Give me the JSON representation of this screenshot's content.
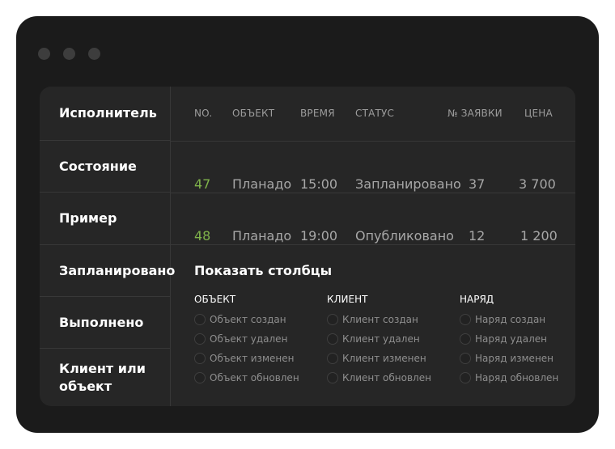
{
  "window": {
    "controls": [
      "window-dot-1",
      "window-dot-2",
      "window-dot-3"
    ]
  },
  "sidebar": {
    "items": [
      {
        "label": "Исполнитель"
      },
      {
        "label": "Состояние"
      },
      {
        "label": "Пример"
      },
      {
        "label": "Запланировано"
      },
      {
        "label": "Выполнено"
      },
      {
        "label": "Клиент или объект"
      }
    ]
  },
  "table": {
    "headers": [
      "NO.",
      "ОБЪЕКТ",
      "ВРЕМЯ",
      "СТАТУС",
      "№ ЗАЯВКИ",
      "ЦЕНА"
    ],
    "rows": [
      {
        "no": "47",
        "object": "Планадо",
        "time": "15:00",
        "status": "Запланировано",
        "request": "37",
        "price": "3 700"
      },
      {
        "no": "48",
        "object": "Планадо",
        "time": "19:00",
        "status": "Опубликовано",
        "request": "12",
        "price": "1 200"
      }
    ],
    "accent_color": "#7fb24a"
  },
  "columns_panel": {
    "title": "Показать столбцы",
    "groups": [
      {
        "title": "ОБЪЕКТ",
        "options": [
          "Объект создан",
          "Объект удален",
          "Объект изменен",
          "Объект обновлен"
        ]
      },
      {
        "title": "КЛИЕНТ",
        "options": [
          "Клиент создан",
          "Клиент удален",
          "Клиент изменен",
          "Клиент обновлен"
        ]
      },
      {
        "title": "НАРЯД",
        "options": [
          "Наряд создан",
          "Наряд удален",
          "Наряд изменен",
          "Наряд обновлен"
        ]
      }
    ]
  }
}
